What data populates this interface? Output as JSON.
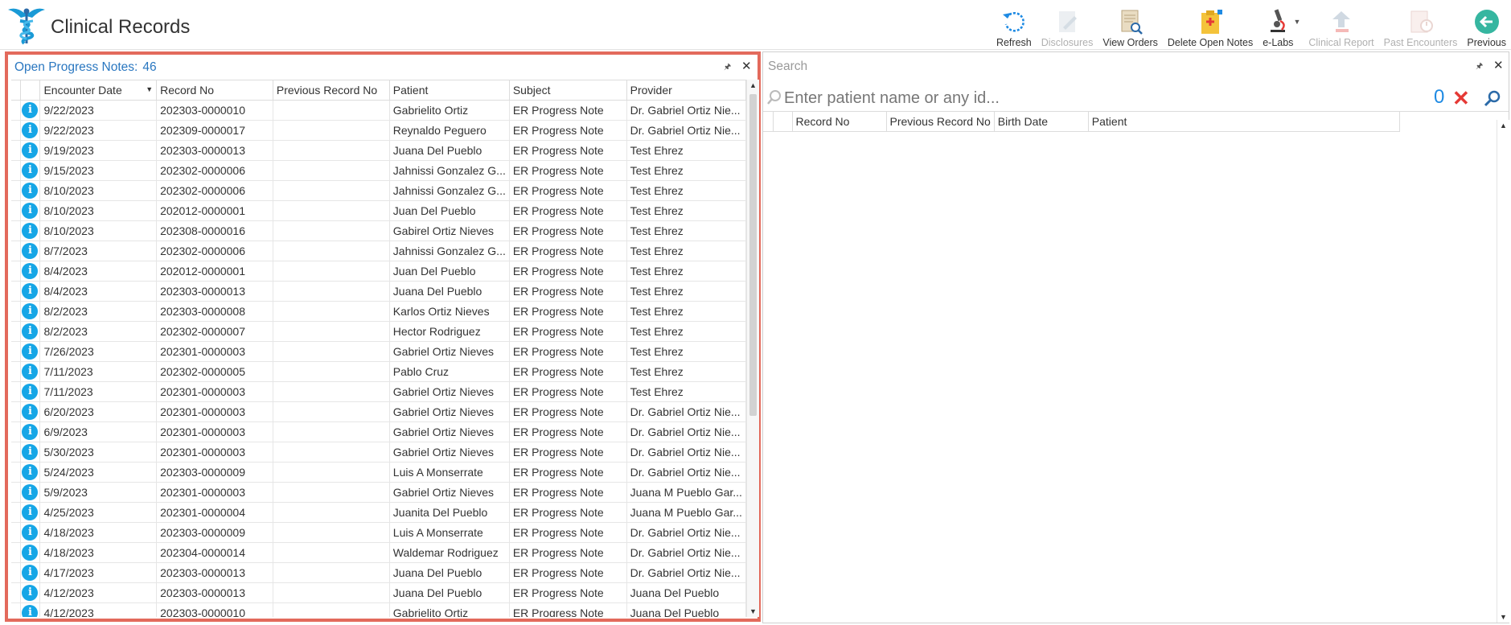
{
  "app": {
    "title": "Clinical Records"
  },
  "toolbar": {
    "buttons": [
      {
        "label": "Refresh",
        "icon": "refresh-icon",
        "enabled": true
      },
      {
        "label": "Disclosures",
        "icon": "disclosures-icon",
        "enabled": false
      },
      {
        "label": "View Orders",
        "icon": "view-orders-icon",
        "enabled": true
      },
      {
        "label": "Delete Open Notes",
        "icon": "delete-notes-icon",
        "enabled": true
      },
      {
        "label": "e-Labs",
        "icon": "microscope-icon",
        "enabled": true,
        "dropdown": true
      },
      {
        "label": "Clinical Report",
        "icon": "clinical-report-icon",
        "enabled": false
      },
      {
        "label": "Past Encounters",
        "icon": "past-encounters-icon",
        "enabled": false
      },
      {
        "label": "Previous",
        "icon": "back-arrow-icon",
        "enabled": true
      }
    ]
  },
  "left_panel": {
    "title": "Open Progress Notes:",
    "count": "46",
    "columns": [
      "Encounter Date",
      "Record No",
      "Previous Record No",
      "Patient",
      "Subject",
      "Provider"
    ],
    "rows": [
      [
        "9/22/2023",
        "202303-0000010",
        "",
        "Gabrielito Ortiz",
        "ER Progress Note",
        "Dr. Gabriel Ortiz Nie..."
      ],
      [
        "9/22/2023",
        "202309-0000017",
        "",
        "Reynaldo Peguero",
        "ER Progress Note",
        "Dr. Gabriel Ortiz Nie..."
      ],
      [
        "9/19/2023",
        "202303-0000013",
        "",
        "Juana Del Pueblo",
        "ER Progress Note",
        "Test Ehrez"
      ],
      [
        "9/15/2023",
        "202302-0000006",
        "",
        "Jahnissi Gonzalez G...",
        "ER Progress Note",
        "Test Ehrez"
      ],
      [
        "8/10/2023",
        "202302-0000006",
        "",
        "Jahnissi Gonzalez G...",
        "ER Progress Note",
        "Test Ehrez"
      ],
      [
        "8/10/2023",
        "202012-0000001",
        "",
        "Juan Del Pueblo",
        "ER Progress Note",
        "Test Ehrez"
      ],
      [
        "8/10/2023",
        "202308-0000016",
        "",
        "Gabirel Ortiz Nieves",
        "ER Progress Note",
        "Test Ehrez"
      ],
      [
        "8/7/2023",
        "202302-0000006",
        "",
        "Jahnissi Gonzalez G...",
        "ER Progress Note",
        "Test Ehrez"
      ],
      [
        "8/4/2023",
        "202012-0000001",
        "",
        "Juan Del Pueblo",
        "ER Progress Note",
        "Test Ehrez"
      ],
      [
        "8/4/2023",
        "202303-0000013",
        "",
        "Juana Del Pueblo",
        "ER Progress Note",
        "Test Ehrez"
      ],
      [
        "8/2/2023",
        "202303-0000008",
        "",
        "Karlos Ortiz Nieves",
        "ER Progress Note",
        "Test Ehrez"
      ],
      [
        "8/2/2023",
        "202302-0000007",
        "",
        "Hector Rodriguez",
        "ER Progress Note",
        "Test Ehrez"
      ],
      [
        "7/26/2023",
        "202301-0000003",
        "",
        "Gabriel Ortiz Nieves",
        "ER Progress Note",
        "Test Ehrez"
      ],
      [
        "7/11/2023",
        "202302-0000005",
        "",
        "Pablo Cruz",
        "ER Progress Note",
        "Test Ehrez"
      ],
      [
        "7/11/2023",
        "202301-0000003",
        "",
        "Gabriel Ortiz Nieves",
        "ER Progress Note",
        "Test Ehrez"
      ],
      [
        "6/20/2023",
        "202301-0000003",
        "",
        "Gabriel Ortiz Nieves",
        "ER Progress Note",
        "Dr. Gabriel Ortiz Nie..."
      ],
      [
        "6/9/2023",
        "202301-0000003",
        "",
        "Gabriel Ortiz Nieves",
        "ER Progress Note",
        "Dr. Gabriel Ortiz Nie..."
      ],
      [
        "5/30/2023",
        "202301-0000003",
        "",
        "Gabriel Ortiz Nieves",
        "ER Progress Note",
        "Dr. Gabriel Ortiz Nie..."
      ],
      [
        "5/24/2023",
        "202303-0000009",
        "",
        "Luis A Monserrate",
        "ER Progress Note",
        "Dr. Gabriel Ortiz Nie..."
      ],
      [
        "5/9/2023",
        "202301-0000003",
        "",
        "Gabriel Ortiz Nieves",
        "ER Progress Note",
        "Juana M Pueblo Gar..."
      ],
      [
        "4/25/2023",
        "202301-0000004",
        "",
        "Juanita Del Pueblo",
        "ER Progress Note",
        "Juana M Pueblo Gar..."
      ],
      [
        "4/18/2023",
        "202303-0000009",
        "",
        "Luis A Monserrate",
        "ER Progress Note",
        "Dr. Gabriel Ortiz Nie..."
      ],
      [
        "4/18/2023",
        "202304-0000014",
        "",
        "Waldemar Rodriguez",
        "ER Progress Note",
        "Dr. Gabriel Ortiz Nie..."
      ],
      [
        "4/17/2023",
        "202303-0000013",
        "",
        "Juana Del Pueblo",
        "ER Progress Note",
        "Dr. Gabriel Ortiz Nie..."
      ],
      [
        "4/12/2023",
        "202303-0000013",
        "",
        "Juana Del Pueblo",
        "ER Progress Note",
        "Juana Del Pueblo"
      ],
      [
        "4/12/2023",
        "202303-0000010",
        "",
        "Gabrielito Ortiz",
        "ER Progress Note",
        "Juana Del Pueblo"
      ]
    ]
  },
  "right_panel": {
    "title": "Search",
    "search": {
      "placeholder": "Enter patient name or any id...",
      "value": ""
    },
    "result_count": "0",
    "columns": [
      "Record No",
      "Previous Record No",
      "Birth Date",
      "Patient"
    ]
  }
}
